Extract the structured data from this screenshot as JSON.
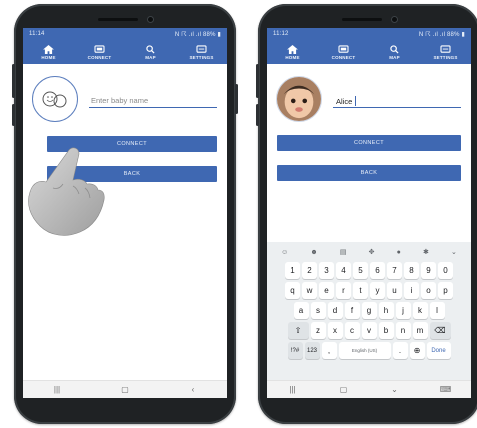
{
  "status_bar": {
    "time_left": "11:14",
    "time_right": "11:12",
    "right": "N ☈ .ıl .ıl 88% ▮"
  },
  "nav": [
    {
      "label": "HOME",
      "icon": "home-icon"
    },
    {
      "label": "CONNECT",
      "icon": "connect-icon"
    },
    {
      "label": "MAP",
      "icon": "map-search-icon"
    },
    {
      "label": "SETTINGS",
      "icon": "settings-icon"
    }
  ],
  "left_screen": {
    "name_placeholder": "Enter baby name",
    "connect_label": "CONNECT",
    "back_label": "BACK"
  },
  "right_screen": {
    "name_value": "Alice",
    "connect_label": "CONNECT",
    "back_label": "BACK"
  },
  "keyboard": {
    "row_numbers": [
      "1",
      "2",
      "3",
      "4",
      "5",
      "6",
      "7",
      "8",
      "9",
      "0"
    ],
    "row_1": [
      "q",
      "w",
      "e",
      "r",
      "t",
      "y",
      "u",
      "i",
      "o",
      "p"
    ],
    "row_2": [
      "a",
      "s",
      "d",
      "f",
      "g",
      "h",
      "j",
      "k",
      "l"
    ],
    "row_3": [
      "z",
      "x",
      "c",
      "v",
      "b",
      "n",
      "m"
    ],
    "sym_label": "!?#",
    "num_label": "123",
    "comma": ",",
    "space_label": "English (US)",
    "period": ".",
    "done_label": "Done"
  },
  "colors": {
    "primary": "#3f68b2",
    "frame": "#1f2224"
  }
}
